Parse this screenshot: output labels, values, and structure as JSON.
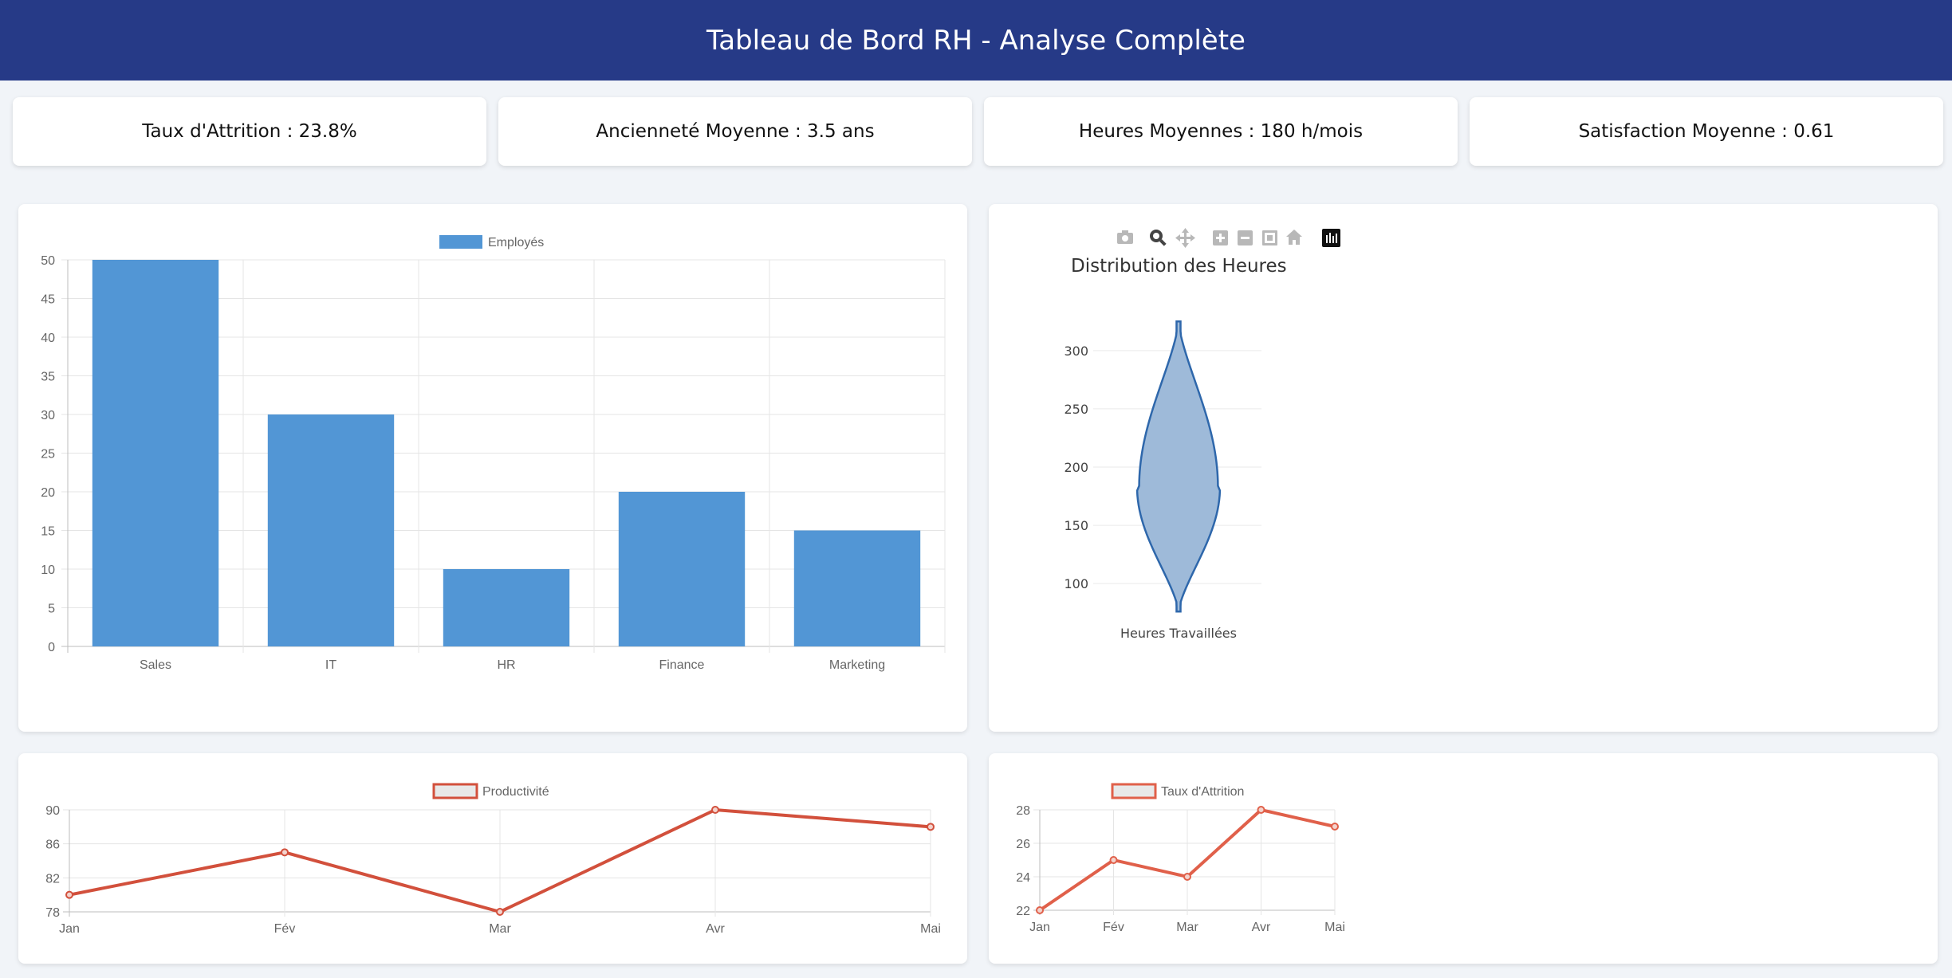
{
  "header": {
    "title": "Tableau de Bord RH - Analyse Complète"
  },
  "kpis": [
    {
      "label": "Taux d'Attrition : 23.8%"
    },
    {
      "label": "Ancienneté Moyenne : 3.5 ans"
    },
    {
      "label": "Heures Moyennes : 180 h/mois"
    },
    {
      "label": "Satisfaction Moyenne : 0.61"
    }
  ],
  "colors": {
    "header_bg": "#263a87",
    "bar": "#5296d5",
    "violin_fill": "#9ebad9",
    "violin_line": "#2e67ab",
    "line_red": "#d2503c",
    "line_orange": "#e0604a"
  },
  "toolbar_icons": [
    "camera-icon",
    "zoom-icon",
    "pan-icon",
    "zoom-in-icon",
    "zoom-out-icon",
    "autoscale-icon",
    "home-icon",
    "plotly-logo-icon"
  ],
  "chart_data": [
    {
      "type": "bar",
      "legend": "Employés",
      "categories": [
        "Sales",
        "IT",
        "HR",
        "Finance",
        "Marketing"
      ],
      "values": [
        50,
        30,
        10,
        20,
        15
      ],
      "y_ticks": [
        "0",
        "5",
        "10",
        "15",
        "20",
        "25",
        "30",
        "35",
        "40",
        "45",
        "50"
      ],
      "ylim": [
        0,
        50
      ]
    },
    {
      "type": "violin",
      "title": "Distribution des Heures",
      "category": "Heures Travaillées",
      "y_ticks": [
        "100",
        "150",
        "200",
        "250",
        "300"
      ],
      "ylim": [
        70,
        330
      ],
      "range": [
        76,
        325
      ],
      "peak": 183
    },
    {
      "type": "line",
      "legend": "Productivité",
      "categories": [
        "Jan",
        "Fév",
        "Mar",
        "Avr",
        "Mai"
      ],
      "values": [
        80,
        85,
        78,
        90,
        88
      ],
      "y_ticks": [
        "78",
        "82",
        "86",
        "90"
      ],
      "ylim": [
        78,
        90
      ]
    },
    {
      "type": "line",
      "legend": "Taux d'Attrition",
      "categories": [
        "Jan",
        "Fév",
        "Mar",
        "Avr",
        "Mai"
      ],
      "values": [
        22,
        25,
        24,
        28,
        27
      ],
      "y_ticks": [
        "22",
        "24",
        "26",
        "28"
      ],
      "ylim": [
        22,
        28
      ]
    }
  ]
}
